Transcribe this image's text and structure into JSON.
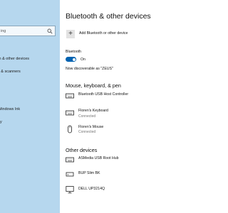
{
  "sidebar": {
    "search_placeholder": "ing",
    "items": [
      {
        "label": "th & other devices"
      },
      {
        "label": "s & scanners"
      },
      {
        "label": "Windows Ink"
      },
      {
        "label": "ay"
      }
    ]
  },
  "main": {
    "title": "Bluetooth & other devices",
    "add_device_label": "Add Bluetooth or other device",
    "add_device_symbol": "+",
    "bluetooth": {
      "label": "Bluetooth",
      "toggle_on": true,
      "state_text": "On",
      "discoverable_text": "Now discoverable as \"ZEUS\""
    },
    "mouse_keyboard_pen": {
      "heading": "Mouse, keyboard, & pen",
      "devices": [
        {
          "name": "Bluetooth USB Host Controller",
          "status": "",
          "icon": "keyboard-icon"
        },
        {
          "name": "Floren's Keyboard",
          "status": "Connected",
          "icon": "keyboard-icon"
        },
        {
          "name": "Floren's Mouse",
          "status": "Connected",
          "icon": "mouse-icon"
        }
      ]
    },
    "other_devices": {
      "heading": "Other devices",
      "devices": [
        {
          "name": "ASMedia USB Root Hub",
          "icon": "usb-hub-icon"
        },
        {
          "name": "BUP Slim BK",
          "icon": "drive-icon"
        },
        {
          "name": "DELL UP3214Q",
          "icon": "monitor-icon"
        }
      ]
    }
  },
  "colors": {
    "sidebar_bg": "#b6d7ee",
    "accent": "#0063b1",
    "connected_text": "#767676"
  }
}
